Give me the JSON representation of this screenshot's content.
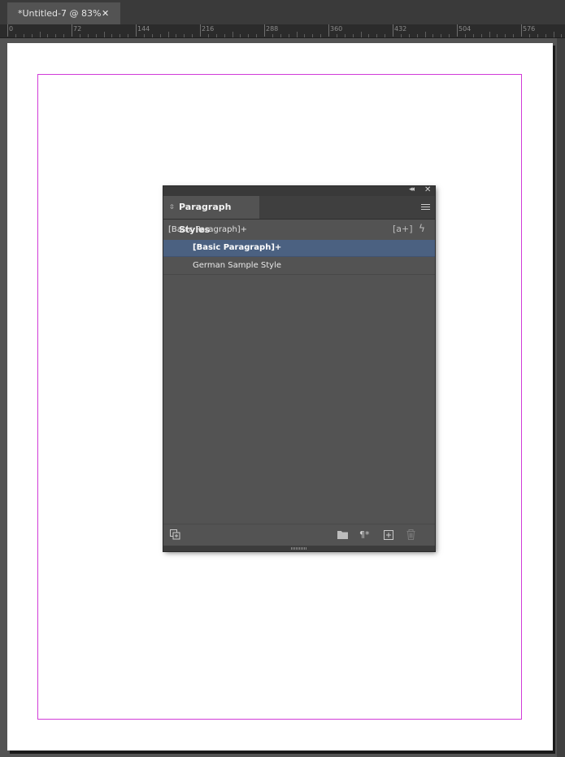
{
  "document_tab": {
    "title": "*Untitled-7 @ 83%",
    "close_glyph": "✕"
  },
  "ruler": {
    "labels": [
      "0",
      "72",
      "144",
      "216",
      "288",
      "360",
      "432",
      "504",
      "576"
    ]
  },
  "panel": {
    "collapse_glyph": "◂◂",
    "close_glyph": "✕",
    "tab_label": "Paragraph Styles",
    "tab_arrows_glyph": "⇳",
    "current_style": "[Basic Paragraph]+",
    "new_style_glyph": "[a+]",
    "quick_apply_glyph": "ϟ",
    "styles": [
      {
        "label": "[Basic Paragraph]+",
        "selected": true
      },
      {
        "label": "German Sample Style",
        "selected": false
      }
    ],
    "bottom_icons": {
      "load_styles": "⍐",
      "new_group": "▬",
      "clear_overrides": "¶*",
      "new_style": "⊞",
      "delete": "🗑"
    }
  },
  "colors": {
    "margin_guide": "#d13bd8",
    "selection": "#4b6181"
  }
}
